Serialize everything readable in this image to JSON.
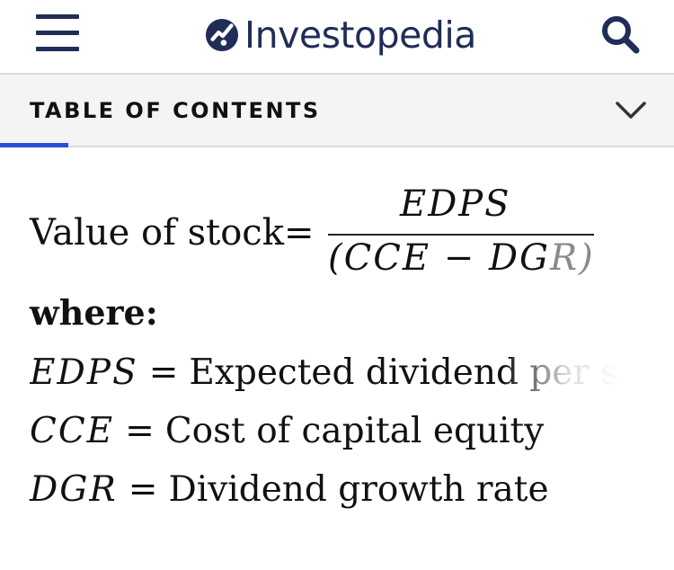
{
  "header": {
    "brand": "Investopedia",
    "menu_icon": "hamburger-menu-icon",
    "search_icon": "search-icon",
    "brand_color": "#1f2d57"
  },
  "toc": {
    "label": "TABLE OF CONTENTS",
    "expand_icon": "chevron-down-icon",
    "indicator_color": "#2650d8"
  },
  "formula": {
    "lhs": "Value of stock",
    "equals": "=",
    "numerator": "EDPS",
    "denominator_main": "(CCE − DG",
    "denominator_fade": "R)"
  },
  "where_label": "where:",
  "definitions": [
    {
      "symbol": "EDPS",
      "equals": "=",
      "text": "Expected dividend per s"
    },
    {
      "symbol": "CCE",
      "equals": "=",
      "text": "Cost of capital equity"
    },
    {
      "symbol": "DGR",
      "equals": "=",
      "text": "Dividend growth rate"
    }
  ]
}
